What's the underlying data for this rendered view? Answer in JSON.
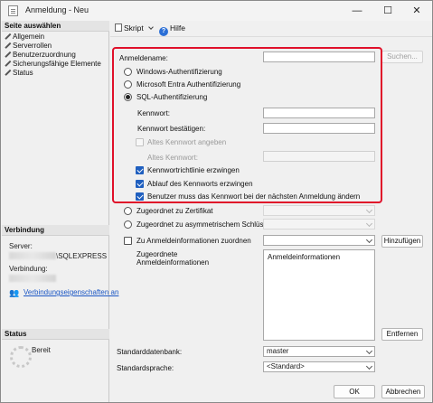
{
  "window": {
    "title": "Anmeldung - Neu",
    "minimize": "—",
    "maximize": "☐",
    "close": "✕"
  },
  "sidebar": {
    "select_page_header": "Seite auswählen",
    "pages": [
      {
        "label": "Allgemein",
        "icon": "wrench-icon"
      },
      {
        "label": "Serverrollen",
        "icon": "wrench-icon"
      },
      {
        "label": "Benutzerzuordnung",
        "icon": "wrench-icon"
      },
      {
        "label": "Sicherungsfähige Elemente",
        "icon": "wrench-icon"
      },
      {
        "label": "Status",
        "icon": "wrench-icon"
      }
    ],
    "connection_header": "Verbindung",
    "server_label": "Server:",
    "server_value": "\\SQLEXPRESS",
    "connection_label": "Verbindung:",
    "connection_props_link": "Verbindungseigenschaften an",
    "status_header": "Status",
    "status_value": "Bereit"
  },
  "toolbar": {
    "script_label": "Skript",
    "help_label": "Hilfe"
  },
  "form": {
    "login_name_label": "Anmeldename:",
    "login_name_value": "",
    "search_button": "Suchen...",
    "auth_options": [
      {
        "label": "Windows-Authentifizierung",
        "selected": false
      },
      {
        "label": "Microsoft Entra Authentifizierung",
        "selected": false
      },
      {
        "label": "SQL-Authentifizierung",
        "selected": true
      }
    ],
    "password_label": "Kennwort:",
    "confirm_password_label": "Kennwort bestätigen:",
    "specify_old_password_label": "Altes Kennwort angeben",
    "old_password_label": "Altes Kennwort:",
    "enforce_policy_label": "Kennwortrichtlinie erzwingen",
    "enforce_policy_checked": true,
    "enforce_expiration_label": "Ablauf des Kennworts erzwingen",
    "enforce_expiration_checked": true,
    "must_change_label": "Benutzer muss das Kennwort bei der nächsten Anmeldung ändern",
    "must_change_checked": true,
    "cert_option_label": "Zugeordnet zu Zertifikat",
    "asym_key_option_label": "Zugeordnet zu asymmetrischem Schlüssel",
    "map_credentials_label": "Zu Anmeldeinformationen zuordnen",
    "map_credentials_checked": false,
    "add_button": "Hinzufügen",
    "mapped_credentials_label": "Zugeordnete Anmeldeinformationen",
    "credentials_column": "Anmeldeinformationen",
    "remove_button": "Entfernen",
    "default_db_label": "Standarddatenbank:",
    "default_db_value": "master",
    "default_lang_label": "Standardsprache:",
    "default_lang_value": "<Standard>"
  },
  "footer": {
    "ok_button": "OK",
    "cancel_button": "Abbrechen"
  },
  "colors": {
    "highlight_border": "#e0102a",
    "checkbox_checked": "#1f5fbf",
    "link": "#1a56c4"
  }
}
